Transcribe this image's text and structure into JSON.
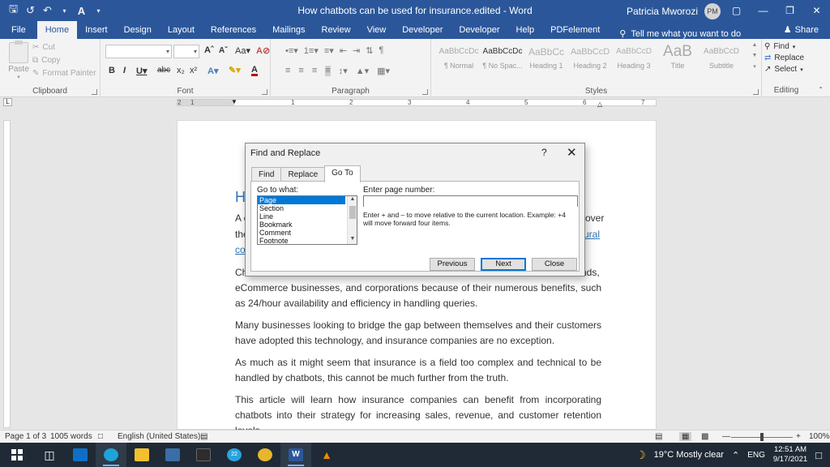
{
  "window": {
    "title": "How chatbots can be used for insurance.edited  -  Word",
    "user_name": "Patricia Mworozi",
    "user_initials": "PM",
    "autosave_label": "A"
  },
  "ribbon_tabs": [
    "File",
    "Home",
    "Insert",
    "Design",
    "Layout",
    "References",
    "Mailings",
    "Review",
    "View",
    "Developer",
    "Developer",
    "Help",
    "PDFelement"
  ],
  "tell_me": "Tell me what you want to do",
  "share_label": "Share",
  "clipboard": {
    "paste": "Paste",
    "cut": "Cut",
    "copy": "Copy",
    "format_painter": "Format Painter",
    "label": "Clipboard"
  },
  "font_group": {
    "label": "Font",
    "font_name": "",
    "font_size": ""
  },
  "paragraph_group": {
    "label": "Paragraph"
  },
  "styles_group": {
    "label": "Styles",
    "items": [
      {
        "sample": "AaBbCcDc",
        "name": "¶ Normal"
      },
      {
        "sample": "AaBbCcDc",
        "name": "¶ No Spac..."
      },
      {
        "sample": "AaBbCc",
        "name": "Heading 1"
      },
      {
        "sample": "AaBbCcD",
        "name": "Heading 2"
      },
      {
        "sample": "AaBbCcD",
        "name": "Heading 3"
      },
      {
        "sample": "AaB",
        "name": "Title"
      },
      {
        "sample": "AaBbCcD",
        "name": "Subtitle"
      }
    ]
  },
  "editing_group": {
    "label": "Editing",
    "find": "Find",
    "replace": "Replace",
    "select": "Select"
  },
  "ruler_numbers": [
    "1",
    "2",
    "1",
    "2",
    "3",
    "4",
    "5",
    "6",
    "7"
  ],
  "document": {
    "heading_fragment": "H",
    "frag_line1_left": "A c",
    "frag_line1_right": "over",
    "frag_line2_left": "the",
    "frag_line2_link": "ural",
    "frag_line3_link": "co",
    "frag_p2_left": "Ch",
    "frag_p2_right": "nds,",
    "p2_line2": "eCommerce businesses, and corporations because of their numerous benefits, such as 24/hour availability and efficiency in handling queries.",
    "p3": "Many businesses looking to bridge the gap between themselves and their customers have adopted this technology, and insurance companies are no exception.",
    "p4": "As much as it might seem that insurance is a field too complex and technical to be handled by chatbots, this cannot be much further from the truth.",
    "p5": "This article will learn how insurance companies can benefit from incorporating chatbots into their strategy for increasing sales, revenue, and customer retention levels."
  },
  "dialog": {
    "title": "Find and Replace",
    "help": "?",
    "tabs": [
      "Find",
      "Replace",
      "Go To"
    ],
    "go_to_what_label": "Go to what:",
    "go_to_items": [
      "Page",
      "Section",
      "Line",
      "Bookmark",
      "Comment",
      "Footnote"
    ],
    "selected_item": "Page",
    "page_number_label": "Enter page number:",
    "page_number_value": "",
    "hint": "Enter + and – to move relative to the current location. Example: +4 will move forward four items.",
    "btn_previous": "Previous",
    "btn_next": "Next",
    "btn_close": "Close"
  },
  "status_bar": {
    "page": "Page 1 of 3",
    "words": "1005 words",
    "language": "English (United States)",
    "zoom": "100%"
  },
  "taskbar": {
    "weather": "19°C  Mostly clear",
    "lang": "ENG",
    "time": "12:51 AM",
    "date": "9/17/2021",
    "badge": "22"
  },
  "colors": {
    "word_blue": "#2b579a",
    "link_blue": "#2e74b5",
    "selection": "#0078d7",
    "taskbar": "#1f2a36"
  }
}
